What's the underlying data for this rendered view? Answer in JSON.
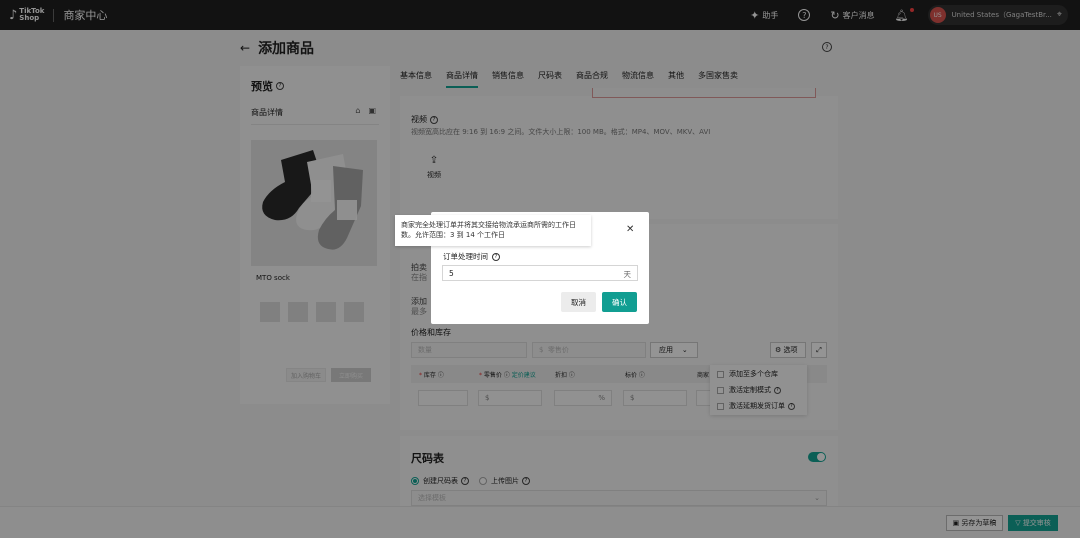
{
  "topbar": {
    "logo_line1": "TikTok",
    "logo_line2": "Shop",
    "title": "商家中心",
    "assistant_label": "助手",
    "messages_label": "客户消息",
    "store_avatar": "US",
    "store_name": "United States（GagaTestBr..."
  },
  "page": {
    "title": "添加商品"
  },
  "preview": {
    "title": "预览",
    "section": "商品详情",
    "product_name": "MTO sock",
    "button1": "加入购物车",
    "button2": "立即购买"
  },
  "tabs": [
    "基本信息",
    "商品详情",
    "销售信息",
    "尺码表",
    "商品合规",
    "物流信息",
    "其他",
    "多国家售卖"
  ],
  "video": {
    "label": "视频",
    "description": "视频宽高比应在 9:16 到 16:9 之间。文件大小上限：100 MB。格式：MP4、MOV、MKV、AVI",
    "upload_label": "视频"
  },
  "sales": {
    "cut_label1": "拍卖",
    "cut_label2": "在指",
    "cut_label3": "添加",
    "cut_label4": "最多",
    "price_inventory_title": "价格和库存",
    "qty_placeholder": "数量",
    "price_placeholder": "零售价",
    "currency": "$",
    "apply_label": "应用",
    "options_label": "选项",
    "col_stock": "库存",
    "col_price": "零售价",
    "col_price_link": "定价建议",
    "col_discount": "折扣",
    "col_list_price": "标价",
    "col_more": "商家",
    "percent": "%"
  },
  "dropdown": {
    "items": [
      "添加至多个仓库",
      "激活定制模式",
      "激活延期发货订单"
    ]
  },
  "size_chart": {
    "title": "尺码表",
    "option1": "创建尺码表",
    "option2": "上传图片",
    "template_placeholder": "选择模板"
  },
  "footer": {
    "draft_label": "另存为草稿",
    "submit_label": "提交审核"
  },
  "dialog": {
    "tooltip": "商家完全处理订单并将其交接给物流承运商所需的工作日数。允许范围：3 到 14 个工作日",
    "field_label": "订单处理时间",
    "field_value": "5",
    "unit": "天",
    "cancel_label": "取消",
    "confirm_label": "确认"
  },
  "colors": {
    "accent": "#14a494",
    "topbar": "#1f1f1f"
  }
}
